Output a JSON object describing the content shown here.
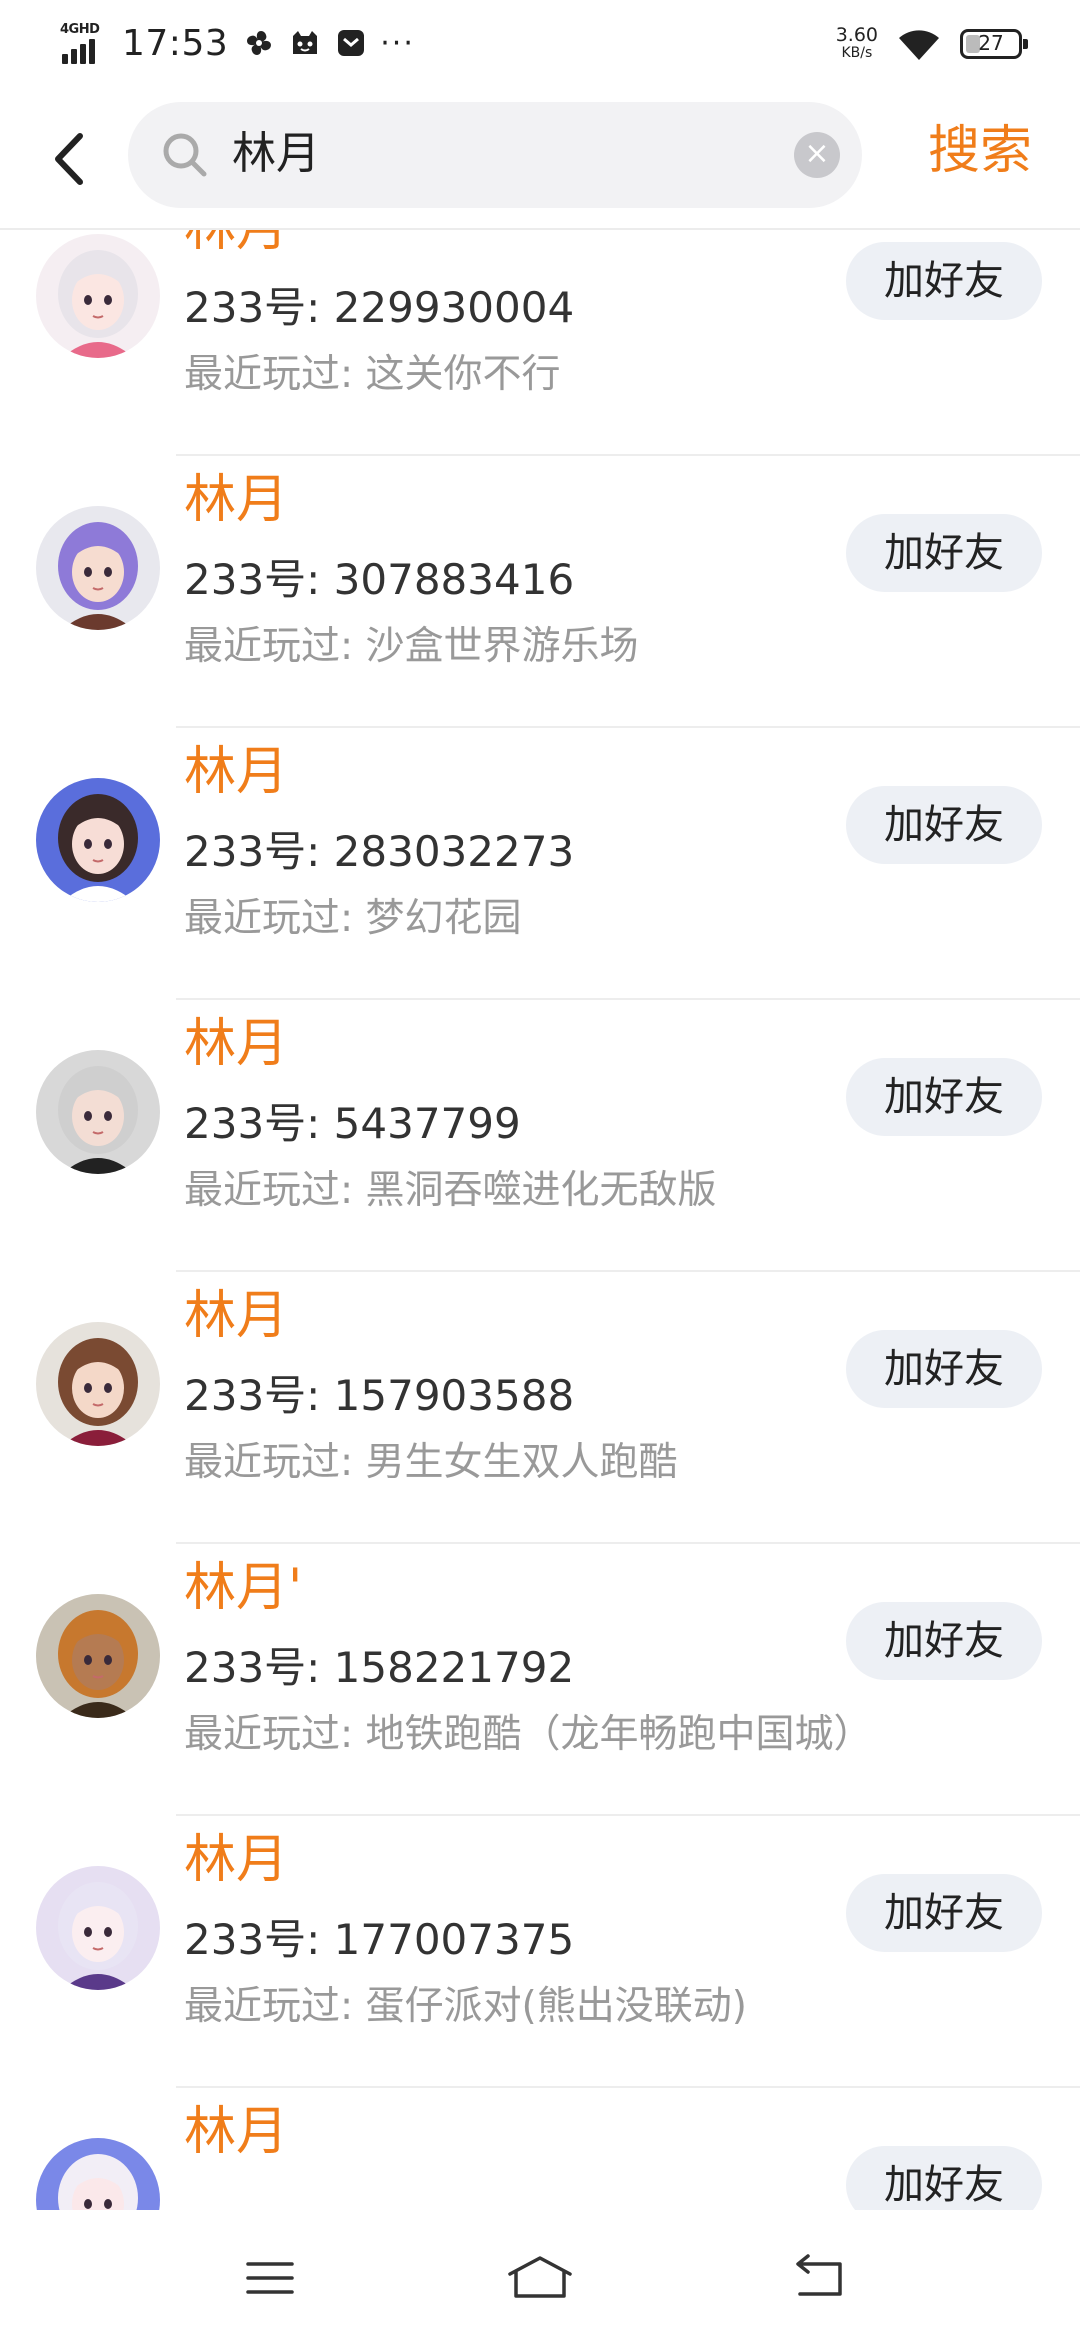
{
  "status_bar": {
    "network": "4GHD",
    "time": "17:53",
    "more": "···",
    "net_speed": "3.60",
    "net_speed_unit": "KB/s",
    "battery": "27",
    "battery_level": 0.27
  },
  "search": {
    "query": "林月",
    "submit_label": "搜索"
  },
  "results": [
    {
      "name": "林月",
      "id": "233号: 229930004",
      "recent": "最近玩过: 这关你不行",
      "button": "加好友"
    },
    {
      "name": "林月",
      "id": "233号: 307883416",
      "recent": "最近玩过: 沙盒世界游乐场",
      "button": "加好友"
    },
    {
      "name": "林月",
      "id": "233号: 283032273",
      "recent": "最近玩过: 梦幻花园",
      "button": "加好友"
    },
    {
      "name": "林月",
      "id": "233号: 5437799",
      "recent": "最近玩过: 黑洞吞噬进化无敌版",
      "button": "加好友"
    },
    {
      "name": "林月",
      "id": "233号: 157903588",
      "recent": "最近玩过: 男生女生双人跑酷",
      "button": "加好友"
    },
    {
      "name": "林月'",
      "id": "233号: 158221792",
      "recent": "最近玩过: 地铁跑酷（龙年畅跑中国城）",
      "button": "加好友"
    },
    {
      "name": "林月",
      "id": "233号: 177007375",
      "recent": "最近玩过: 蛋仔派对(熊出没联动)",
      "button": "加好友"
    },
    {
      "name": "林月",
      "id": "",
      "recent": "",
      "button": "加好友"
    }
  ],
  "colors": {
    "accent": "#f07d1a",
    "button_bg": "#edf0f5",
    "secondary_text": "#999999"
  },
  "icons": {
    "back": "chevron-left-icon",
    "search": "magnifier-icon",
    "clear": "clear-circle-icon",
    "nav_menu": "menu-icon",
    "nav_home": "home-icon",
    "nav_back": "return-icon"
  }
}
